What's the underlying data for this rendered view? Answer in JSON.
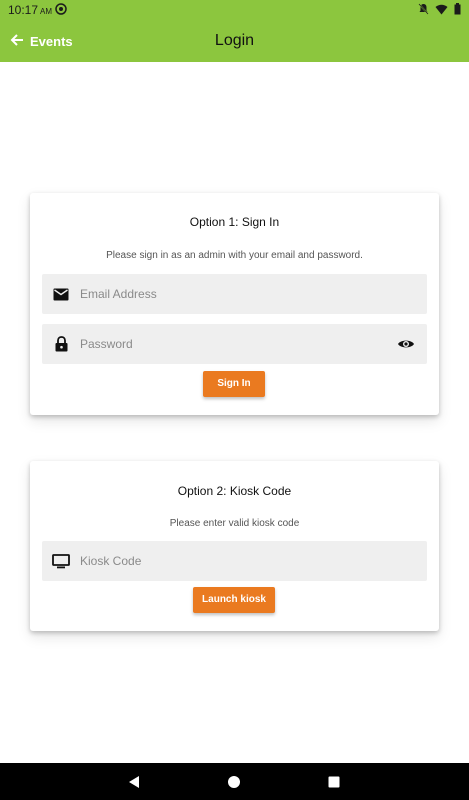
{
  "status_bar": {
    "time": "10:17",
    "ampm": "AM"
  },
  "app_bar": {
    "back_label": "Events",
    "title": "Login",
    "color": "#8cc63e"
  },
  "sign_in_card": {
    "title": "Option 1: Sign In",
    "subtitle": "Please sign in as an admin with your email and password.",
    "email_placeholder": "Email Address",
    "email_value": "",
    "password_placeholder": "Password",
    "password_value": "",
    "button_label": "Sign In"
  },
  "kiosk_card": {
    "title": "Option 2: Kiosk Code",
    "subtitle": "Please enter valid kiosk code",
    "code_placeholder": "Kiosk Code",
    "code_value": "",
    "button_label": "Launch kiosk"
  },
  "accent_color": "#ea7a20",
  "icons": [
    "arrow-left-icon",
    "email-icon",
    "lock-icon",
    "eye-icon",
    "monitor-icon",
    "back-triangle-icon",
    "home-circle-icon",
    "recents-square-icon"
  ]
}
